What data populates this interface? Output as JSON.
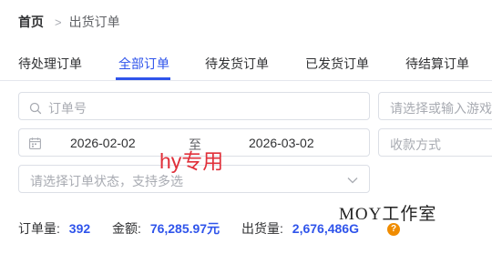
{
  "breadcrumb": {
    "home": "首页",
    "separator": ">",
    "current": "出货订单"
  },
  "tabs": [
    {
      "label": "待处理订单"
    },
    {
      "label": "全部订单"
    },
    {
      "label": "待发货订单"
    },
    {
      "label": "已发货订单"
    },
    {
      "label": "待结算订单"
    }
  ],
  "active_tab": "全部订单",
  "filters": {
    "order_no_placeholder": "订单号",
    "game_placeholder": "请选择或输入游戏",
    "date_start": "2026-02-02",
    "date_separator": "至",
    "date_end": "2026-03-02",
    "receive_method_placeholder": "收款方式",
    "status_placeholder": "请选择订单状态，支持多选"
  },
  "watermarks": {
    "red": "hy专用",
    "studio": "MOY工作室"
  },
  "stats": {
    "order_count_label": "订单量:",
    "order_count": "392",
    "amount_label": "金额:",
    "amount": "76,285.97元",
    "shipped_label": "出货量:",
    "shipped": "2,676,486G"
  },
  "icons": {
    "help": "question-circle-icon",
    "help_color": "#f08c00"
  },
  "colors": {
    "accent": "#2f54eb"
  }
}
